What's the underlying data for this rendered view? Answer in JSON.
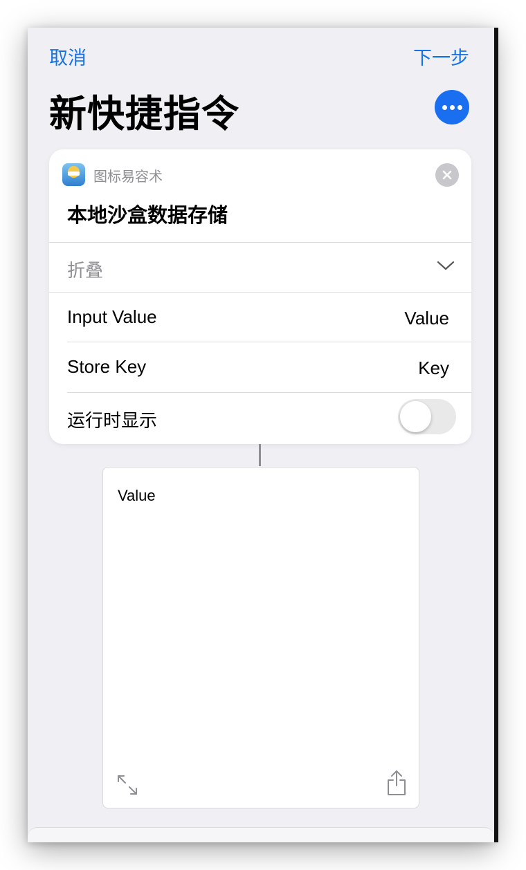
{
  "nav": {
    "cancel_label": "取消",
    "next_label": "下一步"
  },
  "page_title": "新快捷指令",
  "action_card": {
    "app_name": "图标易容术",
    "action_title": "本地沙盒数据存储",
    "collapse_label": "折叠",
    "rows": [
      {
        "label": "Input Value",
        "value": "Value"
      },
      {
        "label": "Store Key",
        "value": "Key"
      }
    ],
    "show_when_run_label": "运行时显示",
    "show_when_run_enabled": false
  },
  "result": {
    "text": "Value"
  },
  "colors": {
    "accent": "#1473e6",
    "more_button": "#1a6ff0",
    "background": "#efeff4"
  },
  "icons": [
    "more-icon",
    "close-icon",
    "chevron-down-icon",
    "expand-icon",
    "share-icon"
  ]
}
